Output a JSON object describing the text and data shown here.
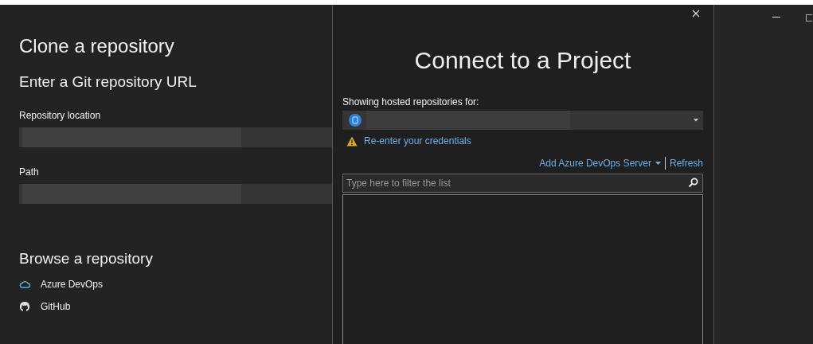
{
  "clone_panel": {
    "title": "Clone a repository",
    "subtitle": "Enter a Git repository URL",
    "fields": [
      {
        "label": "Repository location"
      },
      {
        "label": "Path"
      }
    ],
    "browse_title": "Browse a repository",
    "browse_items": [
      {
        "label": "Azure DevOps",
        "kind": "cloud"
      },
      {
        "label": "GitHub",
        "kind": "github"
      }
    ]
  },
  "dialog": {
    "title": "Connect to a Project",
    "account_label": "Showing hosted repositories for:",
    "warning": "Re-enter your credentials",
    "add_server": "Add Azure DevOps Server",
    "refresh": "Refresh",
    "filter": {
      "placeholder": "Type here to filter the list"
    }
  }
}
